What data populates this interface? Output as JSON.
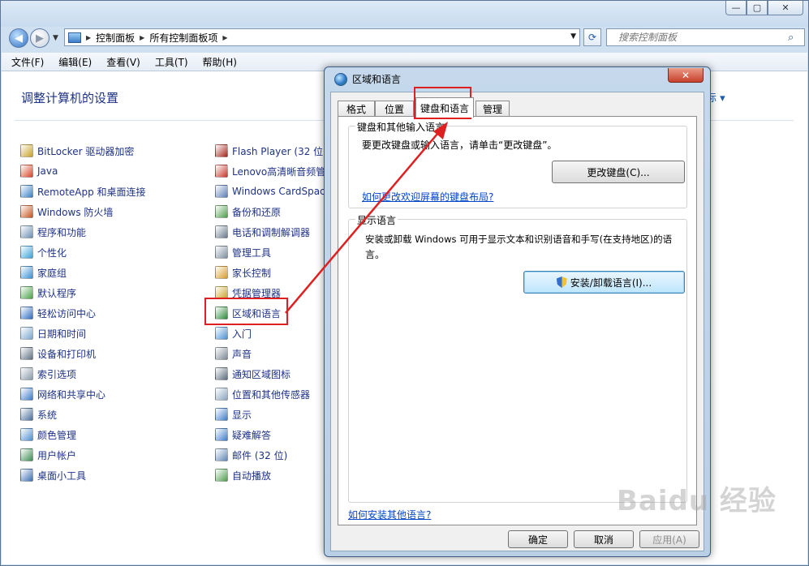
{
  "window": {
    "caption_buttons": {
      "min": "—",
      "max": "▢",
      "close": "✕"
    }
  },
  "nav": {
    "breadcrumbs": [
      "控制面板",
      "所有控制面板项"
    ],
    "search_placeholder": "搜索控制面板"
  },
  "menu": [
    "文件(F)",
    "编辑(E)",
    "查看(V)",
    "工具(T)",
    "帮助(H)"
  ],
  "content": {
    "title": "调整计算机的设置",
    "view_by_partial": "标 ▾",
    "col1": [
      {
        "label": "BitLocker 驱动器加密",
        "color": "#c9a227"
      },
      {
        "label": "Java",
        "color": "#d8452a"
      },
      {
        "label": "RemoteApp 和桌面连接",
        "color": "#3a7fc4"
      },
      {
        "label": "Windows 防火墙",
        "color": "#c6541f"
      },
      {
        "label": "程序和功能",
        "color": "#6b8fb3"
      },
      {
        "label": "个性化",
        "color": "#3aa1d8"
      },
      {
        "label": "家庭组",
        "color": "#3a8fd0"
      },
      {
        "label": "默认程序",
        "color": "#4aa246"
      },
      {
        "label": "轻松访问中心",
        "color": "#2f6cc0"
      },
      {
        "label": "日期和时间",
        "color": "#7aa6cf"
      },
      {
        "label": "设备和打印机",
        "color": "#5f6f82"
      },
      {
        "label": "索引选项",
        "color": "#8a9aab"
      },
      {
        "label": "网络和共享中心",
        "color": "#3d7cc8"
      },
      {
        "label": "系统",
        "color": "#4a6f9c"
      },
      {
        "label": "颜色管理",
        "color": "#4e8fcf"
      },
      {
        "label": "用户帐户",
        "color": "#3c8d54"
      },
      {
        "label": "桌面小工具",
        "color": "#3d6fb0"
      }
    ],
    "col2": [
      {
        "label": "Flash Player (32 位)",
        "color": "#a7241c"
      },
      {
        "label": "Lenovo高清晰音频管",
        "color": "#c8342a"
      },
      {
        "label": "Windows CardSpac",
        "color": "#5b7db6"
      },
      {
        "label": "备份和还原",
        "color": "#4f9e4a"
      },
      {
        "label": "电话和调制解调器",
        "color": "#6b7a8c"
      },
      {
        "label": "管理工具",
        "color": "#7c8d9f"
      },
      {
        "label": "家长控制",
        "color": "#d89a2a"
      },
      {
        "label": "凭据管理器",
        "color": "#c9a227"
      },
      {
        "label": "区域和语言",
        "color": "#2d8a3a"
      },
      {
        "label": "入门",
        "color": "#4a8fd0"
      },
      {
        "label": "声音",
        "color": "#7d8894"
      },
      {
        "label": "通知区域图标",
        "color": "#5c6c7d"
      },
      {
        "label": "位置和其他传感器",
        "color": "#8aa5bf"
      },
      {
        "label": "显示",
        "color": "#3e7ec8"
      },
      {
        "label": "疑难解答",
        "color": "#3e7ec8"
      },
      {
        "label": "邮件 (32 位)",
        "color": "#5f87b5"
      },
      {
        "label": "自动播放",
        "color": "#4e9e4c"
      }
    ]
  },
  "dialog": {
    "title": "区域和语言",
    "close": "✕",
    "tabs": [
      "格式",
      "位置",
      "键盘和语言",
      "管理"
    ],
    "keyboard_group": {
      "title": "键盘和其他输入语言",
      "desc": "要更改键盘或输入语言，请单击“更改键盘”。",
      "button": "更改键盘(C)...",
      "link": "如何更改欢迎屏幕的键盘布局?"
    },
    "display_group": {
      "title": "显示语言",
      "desc_line1": "安装或卸载 Windows 可用于显示文本和识别语音和手写(在支持地区)的语",
      "desc_line2": "言。",
      "button": "安装/卸载语言(I)..."
    },
    "bottom_link": "如何安装其他语言?",
    "ok": "确定",
    "cancel": "取消",
    "apply": "应用(A)"
  },
  "annotation_color": "#e02020",
  "watermark": "Baidu 经验"
}
